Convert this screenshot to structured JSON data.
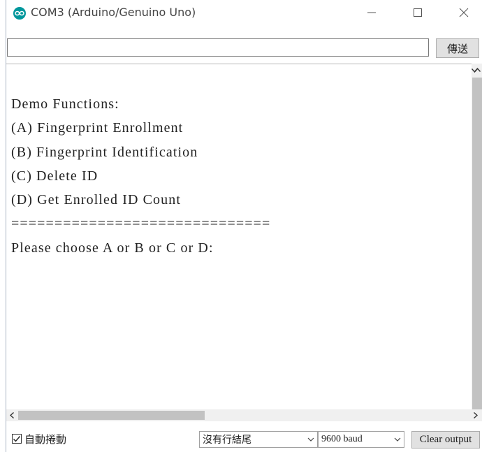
{
  "window": {
    "title": "COM3 (Arduino/Genuino Uno)"
  },
  "send": {
    "input_value": "",
    "button_label": "傳送"
  },
  "output": {
    "lines": [
      "Demo Functions:",
      "(A) Fingerprint Enrollment",
      "(B) Fingerprint Identification",
      "(C) Delete ID",
      "(D) Get Enrolled ID Count",
      "==============================",
      "Please choose A or B or C or D:"
    ]
  },
  "bottom": {
    "autoscroll_label": "自動捲動",
    "autoscroll_checked": true,
    "line_ending": "沒有行結尾",
    "baud_rate": "9600 baud",
    "clear_label": "Clear output"
  },
  "colors": {
    "arduino_teal": "#00979c"
  }
}
